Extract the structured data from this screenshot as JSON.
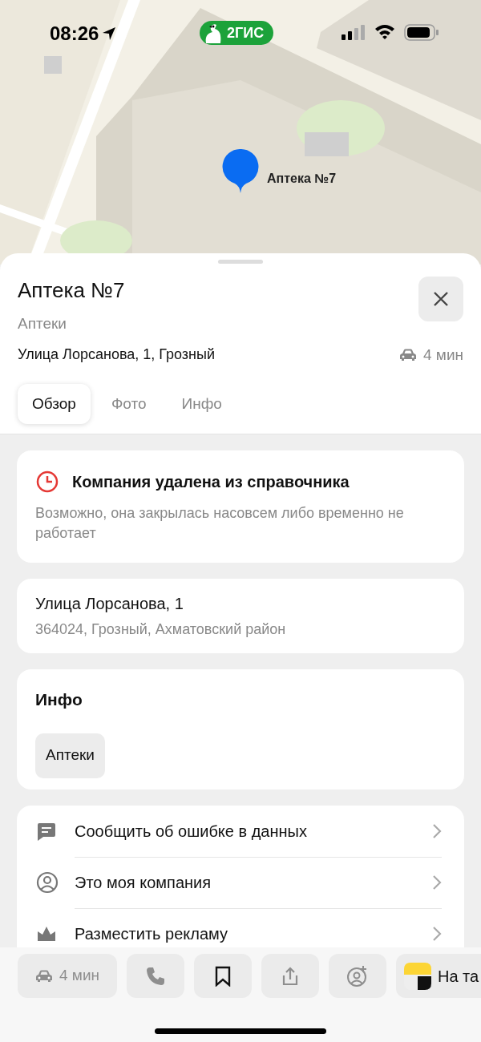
{
  "status_bar": {
    "time": "08:26",
    "app_badge": "2ГИС"
  },
  "map": {
    "marker_label": "Аптека №7"
  },
  "header": {
    "title": "Аптека №7",
    "category": "Аптеки",
    "address": "Улица Лорсанова, 1, Грозный",
    "travel_time": "4 мин"
  },
  "tabs": [
    {
      "label": "Обзор",
      "selected": true
    },
    {
      "label": "Фото",
      "selected": false
    },
    {
      "label": "Инфо",
      "selected": false
    }
  ],
  "notice": {
    "title": "Компания удалена из справочника",
    "text": "Возможно, она закрылась насовсем либо временно не работает"
  },
  "address_card": {
    "street": "Улица Лорсанова, 1",
    "details": "364024, Грозный, Ахматовский район"
  },
  "info": {
    "title": "Инфо",
    "tags": [
      "Аптеки"
    ]
  },
  "actions": [
    {
      "kind": "report",
      "label": "Сообщить об ошибке в данных"
    },
    {
      "kind": "owner",
      "label": "Это моя компания"
    },
    {
      "kind": "ads",
      "label": "Разместить рекламу"
    }
  ],
  "bottom_bar": {
    "route": {
      "label": "4 мин",
      "disabled": true
    },
    "call_disabled": true,
    "bookmark_disabled": false,
    "share_disabled": true,
    "add_friend_disabled": true,
    "taxi": "На та"
  }
}
